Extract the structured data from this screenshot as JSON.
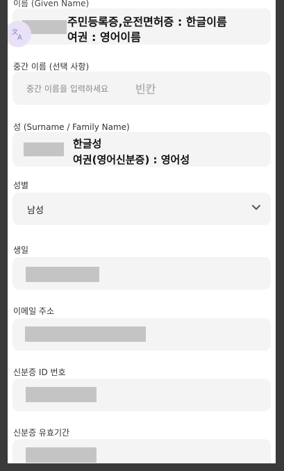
{
  "form": {
    "given_name": {
      "label": "이름 (Given Name)"
    },
    "middle_name": {
      "label": "중간 이름 (선택 사항)",
      "placeholder": "중간 이름을 입력하세요",
      "note": "빈칸"
    },
    "surname": {
      "label": "성 (Surname / Family Name)"
    },
    "gender": {
      "label": "성별",
      "value": "남성"
    },
    "birthday": {
      "label": "생일"
    },
    "email": {
      "label": "이메일 주소"
    },
    "id_number": {
      "label": "신분증 ID 번호"
    },
    "id_expiry": {
      "label": "신분증 유효기간"
    }
  },
  "annotations": {
    "name_line1": "주민등록증,운전면허증 : 한글이름",
    "name_line2": "여권 : 영어이름",
    "surname_line1": "한글성",
    "surname_line2": "여권(영어신분증) : 영어성"
  },
  "icons": {
    "translate": "translate-icon",
    "dropdown": "chevron-down-icon"
  },
  "colors": {
    "field_bg": "#f4f4f4",
    "redaction": "#c4c4c4",
    "badge": "#e9e2f6"
  }
}
